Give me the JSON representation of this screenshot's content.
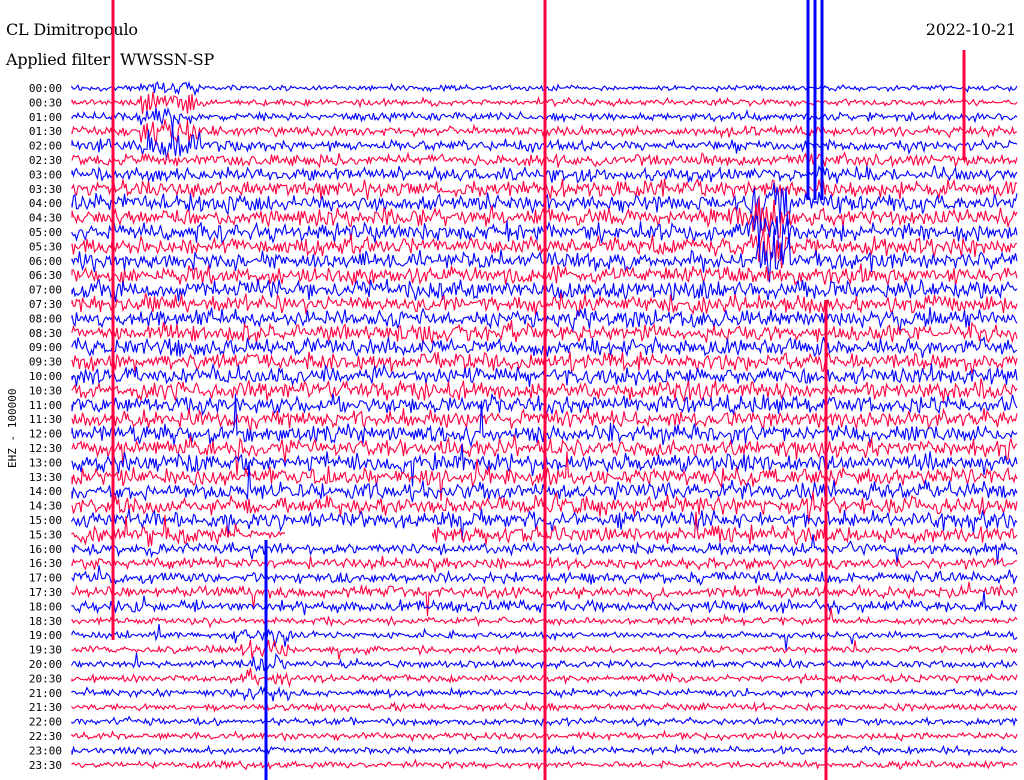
{
  "header": {
    "station": "CL Dimitropoulo",
    "filter": "Applied filter: WWSSN-SP",
    "date": "2022-10-21"
  },
  "chart_data": {
    "type": "seismogram-helicorder",
    "ylabel": "EHZ - 100000",
    "row_labels": [
      "00:00",
      "00:30",
      "01:00",
      "01:30",
      "02:00",
      "02:30",
      "03:00",
      "03:30",
      "04:00",
      "04:30",
      "05:00",
      "05:30",
      "06:00",
      "06:30",
      "07:00",
      "07:30",
      "08:00",
      "08:30",
      "09:00",
      "09:30",
      "10:00",
      "10:30",
      "11:00",
      "11:30",
      "12:00",
      "12:30",
      "13:00",
      "13:30",
      "14:00",
      "14:30",
      "15:00",
      "15:30",
      "16:00",
      "16:30",
      "17:00",
      "17:30",
      "18:00",
      "18:30",
      "19:00",
      "19:30",
      "20:00",
      "20:30",
      "21:00",
      "21:30",
      "22:00",
      "22:30",
      "23:00",
      "23:30"
    ],
    "colors": {
      "even_rows": "#0000ff",
      "odd_rows": "#ff0040"
    },
    "notes": "rows alternate blue/red; amplitude elevated roughly 03:30-16:00; data gap in 15:30 row"
  }
}
